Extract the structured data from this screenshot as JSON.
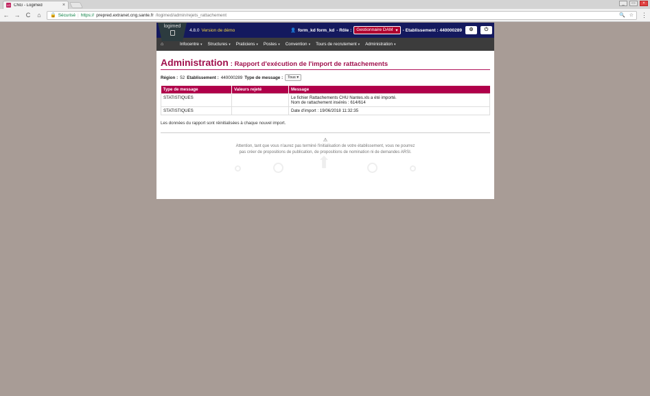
{
  "browser": {
    "tab_favicon": "LG",
    "tab_title": "CNG - Logimed",
    "tab_close": "×",
    "window_controls": [
      "_",
      "▭",
      "×"
    ],
    "nav_back": "←",
    "nav_forward": "→",
    "nav_reload": "C",
    "nav_home": "⌂",
    "secure_label": "Sécurisé",
    "url_scheme": "https://",
    "url_host": "prepred.extranet.cng.sante.fr",
    "url_path": "/logimed/admin/rejets_rattachement",
    "zoom_icon": "🔍",
    "star_icon": "☆",
    "menu_icon": "⋮"
  },
  "app": {
    "logo_text": "logimed",
    "version": "4.8.0",
    "demo_label": "Version de démo",
    "user_label": "form_kd form_kd",
    "role_label": "- Rôle :",
    "role_value": "Gestionnaire DAM",
    "etab_label": "- Etablissement : 440000289",
    "settings_icon": "⚙",
    "power_icon": "⏻"
  },
  "menu": {
    "home_icon": "⌂",
    "items": [
      {
        "label": "Infocentre"
      },
      {
        "label": "Structures"
      },
      {
        "label": "Praticiens"
      },
      {
        "label": "Postes"
      },
      {
        "label": "Convention"
      },
      {
        "label": "Tours de recrutement"
      },
      {
        "label": "Administration"
      }
    ],
    "caret": "▾"
  },
  "page": {
    "title": "Administration",
    "subtitle": ": Rapport d'exécution de l'import de rattachements",
    "region_label": "Région :",
    "region_value": "52",
    "etab_label": "Etablissement :",
    "etab_value": "440000289",
    "type_label": "Type de message :",
    "type_value": "Tous ▾"
  },
  "table": {
    "headers": [
      "Type de message",
      "Valeurs rejeté",
      "Message"
    ],
    "rows": [
      {
        "type": "STATISTIQUES",
        "rejected": "",
        "message_line1": "Le fichier Rattachements CHU Nantes.xls a été importé.",
        "message_line2": "Nom de rattachement insérés : 614/614"
      },
      {
        "type": "STATISTIQUES",
        "rejected": "",
        "message_line1": "Date d'import : 19/06/2018 11:32:35",
        "message_line2": ""
      }
    ]
  },
  "footer": {
    "note": "Les données du rapport sont réinitialisées à chaque nouvel import.",
    "warning_icon": "⚠",
    "warning_line1": "Attention, tant que vous n'aurez pas terminé l'initialisation de votre établissement, vous ne pourrez",
    "warning_line2": "pas créer de propositions de publication, de propositions de nomination ni de demandes ARSI."
  }
}
